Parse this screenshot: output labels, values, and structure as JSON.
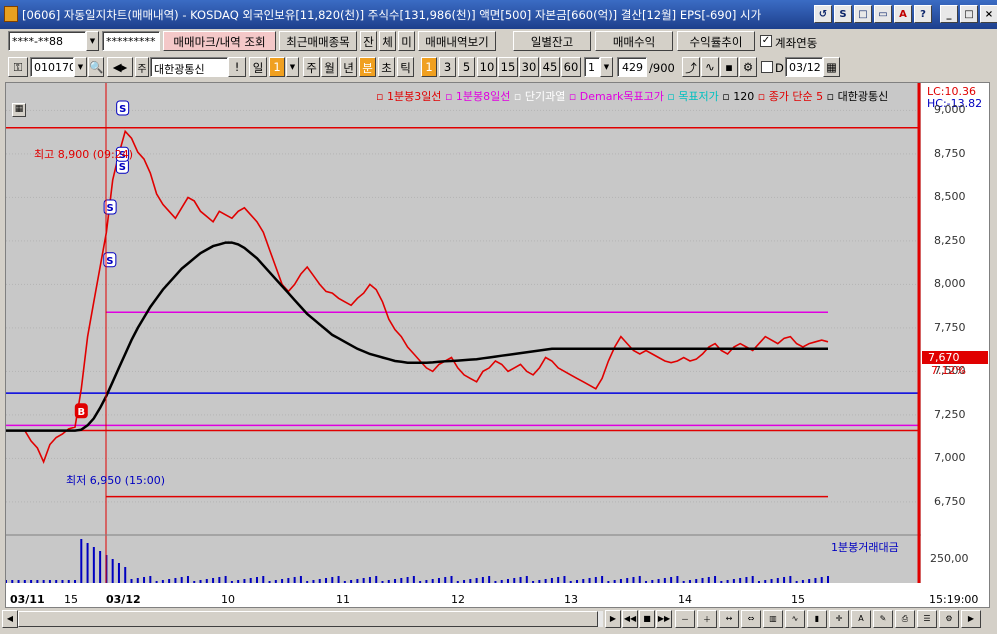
{
  "titlebar": {
    "text": "[0606] 자동일지차트(매매내역) - KOSDAQ 외국인보유[11,820(천)] 주식수[131,986(천)] 액면[500] 자본금[660(억)] 결산[12월] EPS[-690] 시가",
    "tool_icons": [
      "↺",
      "S",
      "□",
      "▭",
      "A",
      "?"
    ],
    "win_buttons": [
      "_",
      "□",
      "×"
    ]
  },
  "toolbar1": {
    "account_value": "****-**88",
    "password_value": "*********",
    "trade_mark_label": "매매마크/내역 조회",
    "recent_trades_label": "최근매매종목",
    "balance_label": "잔",
    "fill_label": "체",
    "unfilled_label": "미",
    "trade_history_label": "매매내역보기",
    "daily_balance_label": "일별잔고",
    "trade_profit_label": "매매수익",
    "return_trend_label": "수익률추이",
    "account_link_label": "계좌연동",
    "account_link_checked": "✓"
  },
  "toolbar2": {
    "stock_code": "010170",
    "stock_name": "대한광통신",
    "stock_badge": "주",
    "exclaim": "!",
    "period_day": "일",
    "period_num": "1",
    "period_week": "주",
    "period_month": "월",
    "period_year": "년",
    "period_min": "분",
    "period_sec": "초",
    "period_tick": "틱",
    "intervals": [
      "1",
      "3",
      "5",
      "10",
      "15",
      "30",
      "45",
      "60"
    ],
    "count_value": "1",
    "bars_value": "429",
    "bars_total": "/900",
    "d_label": "D",
    "date_value": "03/12"
  },
  "chart_data": {
    "type": "line",
    "legend": [
      {
        "label": "1분봉3일선",
        "color": "#e00000"
      },
      {
        "label": "1분봉8일선",
        "color": "#e000e0"
      },
      {
        "label": "단기과열",
        "color": "#ffffff"
      },
      {
        "label": "Demark목표고가",
        "color": "#e000e0"
      },
      {
        "label": "목표저가",
        "color": "#00c0c0"
      },
      {
        "label": "120",
        "color": "#000000"
      },
      {
        "label": "종가 단순 5",
        "color": "#e00000"
      },
      {
        "label": "대한광통신",
        "color": "#000000"
      }
    ],
    "lc_label": "LC:10.36",
    "hc_label": "HC:-13.82",
    "current_price": "7,670",
    "current_pct": "7.12%",
    "high_annotation": "최고 8,900 (09:24)",
    "low_annotation": "최저 6,950 (15:00)",
    "volume_legend": "1분봉거래대금",
    "volume_tick": "250,00",
    "y_ticks": [
      "9,000",
      "8,750",
      "8,500",
      "8,250",
      "8,000",
      "7,750",
      "7,500",
      "7,250",
      "7,000",
      "6,750"
    ],
    "y_values": [
      9000,
      8750,
      8500,
      8250,
      8000,
      7750,
      7500,
      7250,
      7000,
      6750
    ],
    "x_labels": [
      "03/11",
      "15",
      "03/12",
      "10",
      "11",
      "12",
      "13",
      "14",
      "15"
    ],
    "time_label": "15:19:00",
    "ylim": [
      6600,
      9100
    ],
    "hlines": [
      {
        "value": 8900,
        "color": "#e00000",
        "label": "high"
      },
      {
        "value": 7840,
        "color": "#e000e0",
        "label": "demark-high"
      },
      {
        "value": 7375,
        "color": "#0000e0",
        "label": "target-low"
      },
      {
        "value": 7190,
        "color": "#e000e0",
        "label": "demark-low"
      },
      {
        "value": 7160,
        "color": "#e00000",
        "label": "prev-close"
      },
      {
        "value": 6780,
        "color": "#e00000",
        "label": "low-line"
      }
    ],
    "price_series": [
      7160,
      7160,
      7160,
      7160,
      7100,
      7060,
      6980,
      7080,
      7120,
      7140,
      7170,
      7180,
      7400,
      7700,
      7900,
      8100,
      8300,
      8600,
      8750,
      8880,
      8840,
      8760,
      8720,
      8640,
      8520,
      8460,
      8420,
      8380,
      8440,
      8500,
      8480,
      8420,
      8390,
      8360,
      8420,
      8400,
      8380,
      8420,
      8440,
      8400,
      8360,
      8300,
      8200,
      8100,
      8000,
      7960,
      8000,
      8060,
      8100,
      8050,
      8000,
      7960,
      7950,
      7920,
      7900,
      7880,
      7920,
      7950,
      8000,
      7970,
      7900,
      7800,
      7740,
      7700,
      7640,
      7600,
      7560,
      7520,
      7500,
      7540,
      7560,
      7580,
      7520,
      7480,
      7460,
      7440,
      7500,
      7520,
      7560,
      7540,
      7500,
      7520,
      7540,
      7500,
      7480,
      7520,
      7580,
      7560,
      7520,
      7500,
      7480,
      7460,
      7440,
      7420,
      7400,
      7460,
      7560,
      7640,
      7700,
      7660,
      7620,
      7600,
      7620,
      7600,
      7580,
      7560,
      7550,
      7560,
      7580,
      7560,
      7570,
      7600,
      7640,
      7660,
      7620,
      7600,
      7640,
      7660,
      7640,
      7620,
      7660,
      7700,
      7680,
      7660,
      7690,
      7700,
      7660,
      7640,
      7660,
      7670,
      7680,
      7670
    ],
    "ma120_series": [
      7160,
      7160,
      7160,
      7160,
      7160,
      7160,
      7160,
      7160,
      7160,
      7160,
      7160,
      7160,
      7165,
      7190,
      7230,
      7290,
      7360,
      7440,
      7520,
      7600,
      7680,
      7750,
      7810,
      7870,
      7920,
      7970,
      8010,
      8050,
      8090,
      8120,
      8150,
      8180,
      8200,
      8220,
      8230,
      8240,
      8240,
      8230,
      8210,
      8180,
      8150,
      8110,
      8070,
      8030,
      7990,
      7950,
      7910,
      7870,
      7830,
      7800,
      7770,
      7740,
      7710,
      7690,
      7670,
      7650,
      7630,
      7615,
      7600,
      7590,
      7580,
      7570,
      7560,
      7555,
      7550,
      7550,
      7550,
      7550,
      7552,
      7555,
      7558,
      7560,
      7562,
      7565,
      7568,
      7570,
      7575,
      7580,
      7585,
      7590,
      7595,
      7600,
      7605,
      7610,
      7615,
      7620,
      7625,
      7630,
      7630,
      7630,
      7630,
      7630,
      7630,
      7630,
      7630,
      7630,
      7630,
      7630,
      7630,
      7630,
      7630,
      7630,
      7630,
      7630,
      7630,
      7630,
      7630,
      7630,
      7630,
      7630,
      7630,
      7630,
      7630,
      7630,
      7630,
      7630,
      7630,
      7630,
      7630,
      7630,
      7630,
      7630,
      7630,
      7630,
      7630,
      7630,
      7630,
      7630,
      7630,
      7630,
      7630,
      7630
    ],
    "markers": [
      "B",
      "S",
      "S",
      "S",
      "S",
      "S"
    ]
  },
  "scroll": {
    "left": "◀",
    "right": "▶",
    "nav": [
      "▶",
      "◀◀",
      "■",
      "▶▶"
    ]
  }
}
